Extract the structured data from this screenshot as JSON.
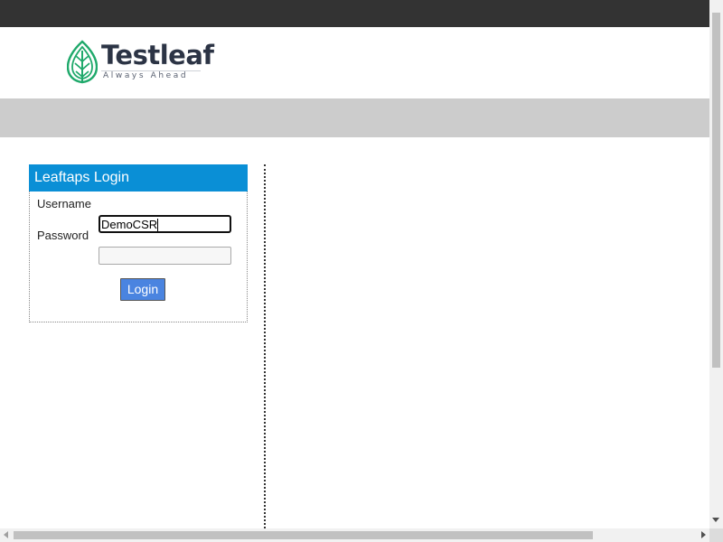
{
  "header": {
    "logo_name": "Testleaf",
    "logo_tagline": "Always Ahead",
    "logo_icon": "leaf-icon",
    "brand_color": "#1fa96b",
    "topbar_color": "#333333",
    "navband_color": "#cccccc"
  },
  "login": {
    "title": "Leaftaps Login",
    "title_bg_color": "#0a8fd6",
    "username_label": "Username",
    "username_value": "DemoCSR",
    "password_label": "Password",
    "password_value": "",
    "submit_label": "Login",
    "submit_color": "#4a84e0"
  },
  "scrollbars": {
    "vertical_icon_down": "chevron-down-icon",
    "horizontal_icon_left": "chevron-left-icon",
    "horizontal_icon_right": "chevron-right-icon"
  }
}
